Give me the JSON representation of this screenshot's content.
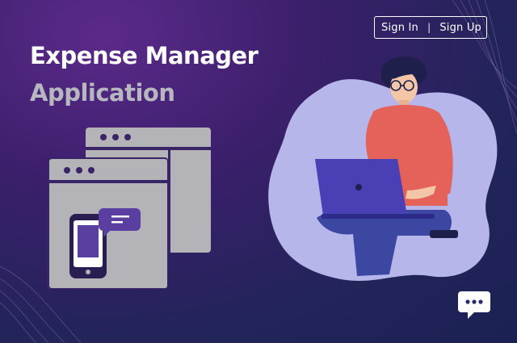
{
  "header": {
    "sign_in_label": "Sign In",
    "separator": "|",
    "sign_up_label": "Sign Up"
  },
  "hero": {
    "title_line1": "Expense Manager",
    "title_line2": "Application"
  },
  "colors": {
    "background_top": "#5b2a8a",
    "background_bottom": "#1b2153",
    "title_primary": "#ffffff",
    "title_secondary": "#b7b7bf",
    "illustration_gray": "#b3b3b8",
    "blob": "#b7b6ea",
    "shirt": "#e4625a",
    "laptop": "#4a3fb5",
    "pants": "#3b47a0"
  },
  "icons": {
    "window_dots": "three-dots",
    "phone": "smartphone-icon",
    "message_bubble": "chat-bubble-icon",
    "chat_fab": "chat-bubble-dots-icon"
  }
}
